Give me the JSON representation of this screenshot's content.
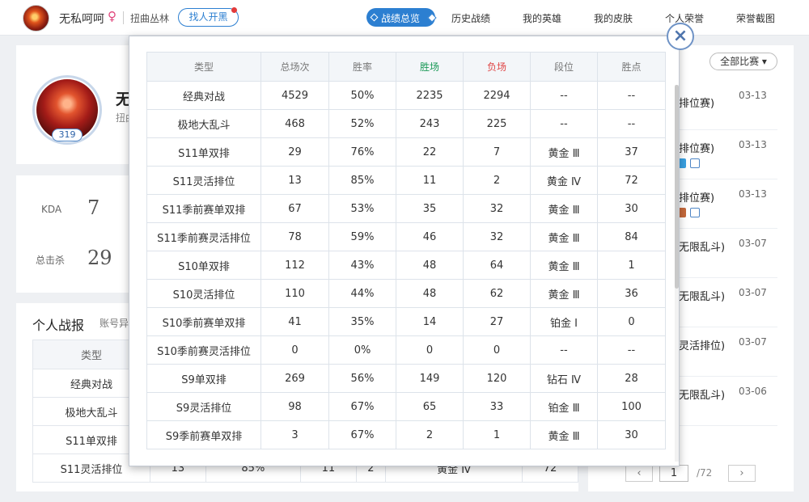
{
  "topbar": {
    "player_name": "无私呵呵",
    "gender_symbol": "♀",
    "region": "扭曲丛林",
    "find_button": "找人开黑"
  },
  "nav": {
    "items": [
      {
        "label": "战绩总览",
        "active": true
      },
      {
        "label": "历史战绩"
      },
      {
        "label": "我的英雄"
      },
      {
        "label": "我的皮肤"
      },
      {
        "label": "个人荣誉"
      },
      {
        "label": "荣誉截图"
      }
    ]
  },
  "profile": {
    "name_partial": "无",
    "region_partial": "扭曲",
    "level": "319"
  },
  "stats": {
    "kda_label": "KDA",
    "kda_value": "7",
    "kills_label": "总击杀",
    "kills_value": "29"
  },
  "report": {
    "title": "个人战报",
    "subtitle": "账号异",
    "header_type": "类型",
    "rows": [
      {
        "type": "经典对战"
      },
      {
        "type": "极地大乱斗"
      },
      {
        "type": "S11单双排"
      },
      {
        "type": "S11灵活排位",
        "c1": "13",
        "c2": "85%",
        "c3": "11",
        "c4": "2",
        "c5": "黄金 Ⅳ",
        "c6": "72"
      }
    ]
  },
  "matches": {
    "filter_label": "全部比赛 ▾",
    "items": [
      {
        "type": "排位赛)",
        "date": "03-13"
      },
      {
        "type": "排位赛)",
        "date": "03-13"
      },
      {
        "type": "排位赛)",
        "date": "03-13"
      },
      {
        "type": "无限乱斗)",
        "date": "03-07"
      },
      {
        "type": "无限乱斗)",
        "date": "03-07"
      },
      {
        "type": "灵活排位)",
        "date": "03-07"
      },
      {
        "type": "无限乱斗)",
        "date": "03-06"
      }
    ],
    "pager": {
      "prev": "‹",
      "current": "1",
      "total": "/72",
      "next": "›"
    }
  },
  "modal": {
    "close_label": "×",
    "headers": [
      "类型",
      "总场次",
      "胜率",
      "胜场",
      "负场",
      "段位",
      "胜点"
    ],
    "rows": [
      [
        "经典对战",
        "4529",
        "50%",
        "2235",
        "2294",
        "--",
        "--"
      ],
      [
        "极地大乱斗",
        "468",
        "52%",
        "243",
        "225",
        "--",
        "--"
      ],
      [
        "S11单双排",
        "29",
        "76%",
        "22",
        "7",
        "黄金 Ⅲ",
        "37"
      ],
      [
        "S11灵活排位",
        "13",
        "85%",
        "11",
        "2",
        "黄金 Ⅳ",
        "72"
      ],
      [
        "S11季前赛单双排",
        "67",
        "53%",
        "35",
        "32",
        "黄金 Ⅲ",
        "30"
      ],
      [
        "S11季前赛灵活排位",
        "78",
        "59%",
        "46",
        "32",
        "黄金 Ⅲ",
        "84"
      ],
      [
        "S10单双排",
        "112",
        "43%",
        "48",
        "64",
        "黄金 Ⅲ",
        "1"
      ],
      [
        "S10灵活排位",
        "110",
        "44%",
        "48",
        "62",
        "黄金 Ⅲ",
        "36"
      ],
      [
        "S10季前赛单双排",
        "41",
        "35%",
        "14",
        "27",
        "铂金 Ⅰ",
        "0"
      ],
      [
        "S10季前赛灵活排位",
        "0",
        "0%",
        "0",
        "0",
        "--",
        "--"
      ],
      [
        "S9单双排",
        "269",
        "56%",
        "149",
        "120",
        "钻石 Ⅳ",
        "28"
      ],
      [
        "S9灵活排位",
        "98",
        "67%",
        "65",
        "33",
        "铂金 Ⅲ",
        "100"
      ],
      [
        "S9季前赛单双排",
        "3",
        "67%",
        "2",
        "1",
        "黄金 Ⅲ",
        "30"
      ]
    ]
  }
}
